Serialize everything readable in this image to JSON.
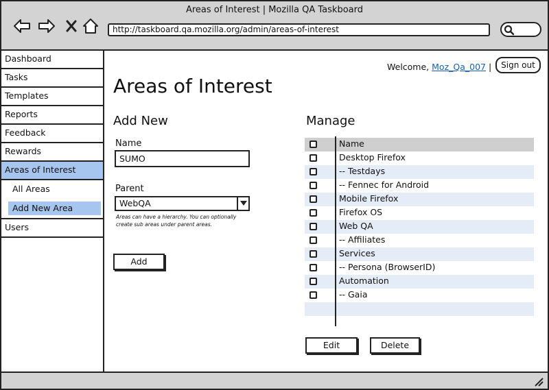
{
  "window": {
    "title": "Areas of Interest | Mozilla QA Taskboard",
    "url": "http://taskboard.qa.mozilla.org/admin/areas-of-interest"
  },
  "sidebar": {
    "items": [
      {
        "label": "Dashboard"
      },
      {
        "label": "Tasks"
      },
      {
        "label": "Templates"
      },
      {
        "label": "Reports"
      },
      {
        "label": "Feedback"
      },
      {
        "label": "Rewards"
      },
      {
        "label": "Areas of Interest"
      }
    ],
    "subitems": [
      {
        "label": "All Areas"
      },
      {
        "label": "Add New Area"
      }
    ],
    "after": {
      "label": "Users"
    }
  },
  "header": {
    "welcome_prefix": "Welcome,",
    "username": "Moz_Qa_007",
    "separator": "|",
    "signout_label": "Sign out"
  },
  "page": {
    "title": "Areas of Interest"
  },
  "add_new": {
    "title": "Add New",
    "name_label": "Name",
    "name_value": "SUMO",
    "parent_label": "Parent",
    "parent_value": "WebQA",
    "hint": "Areas can have a hierarchy. You can optionally create sub areas  under parent areas.",
    "add_label": "Add"
  },
  "manage": {
    "title": "Manage",
    "header": "Name",
    "rows": [
      "Desktop Firefox",
      "-- Testdays",
      "-- Fennec for Android",
      "Mobile Firefox",
      "Firefox OS",
      "Web QA",
      "-- Affiliates",
      "Services",
      "-- Persona (BrowserID)",
      "Automation",
      "-- Gaia"
    ],
    "edit_label": "Edit",
    "delete_label": "Delete"
  },
  "colors": {
    "active": "#a7c6ef",
    "alt_row": "#e4ecf7",
    "header_row": "#cfcfcf",
    "chrome": "#d3d3d3",
    "link": "#1a5fb4"
  }
}
